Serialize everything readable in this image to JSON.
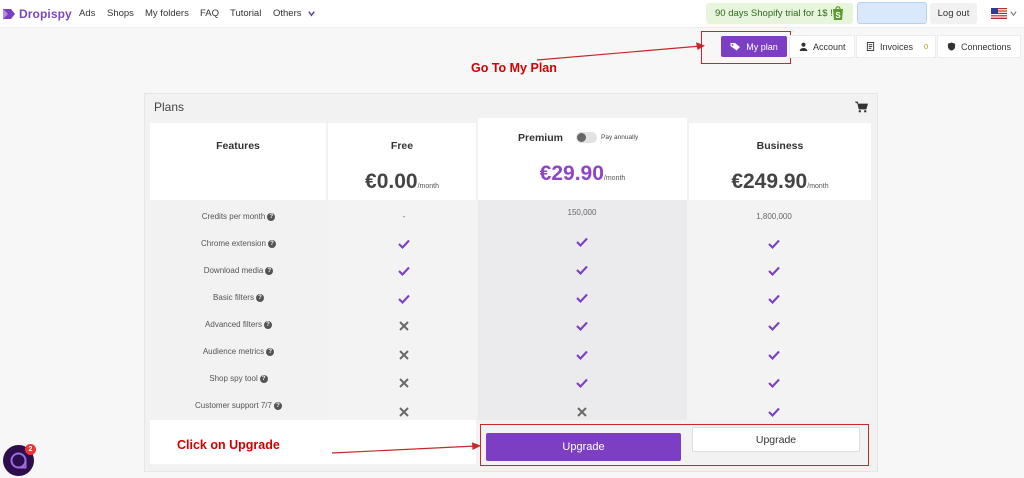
{
  "brand": {
    "name": "Dropispy"
  },
  "nav": {
    "items": [
      "Ads",
      "Shops",
      "My folders",
      "FAQ",
      "Tutorial",
      "Others"
    ],
    "promo": "90 days Shopify trial for 1$ !",
    "logout": "Log out",
    "search_placeholder": "",
    "flag": "us-flag-icon"
  },
  "subnav": {
    "my_plan": "My plan",
    "account": "Account",
    "invoices": "Invoices",
    "invoices_count": "0",
    "connections": "Connections"
  },
  "annotations": {
    "go_to_my_plan": "Go To My Plan",
    "click_on_upgrade": "Click on Upgrade"
  },
  "plans": {
    "title": "Plans",
    "features_header": "Features",
    "pay_annually": "Pay annually",
    "columns": [
      {
        "name": "Free",
        "price": "€0.00",
        "per": "/month"
      },
      {
        "name": "Premium",
        "price": "€29.90",
        "per": "/month"
      },
      {
        "name": "Business",
        "price": "€249.90",
        "per": "/month"
      }
    ],
    "features": [
      {
        "label": "Credits per month",
        "free": "-",
        "premium": "150,000",
        "business": "1,800,000"
      },
      {
        "label": "Chrome extension",
        "free": "check",
        "premium": "check",
        "business": "check"
      },
      {
        "label": "Download media",
        "free": "check",
        "premium": "check",
        "business": "check"
      },
      {
        "label": "Basic filters",
        "free": "check",
        "premium": "check",
        "business": "check"
      },
      {
        "label": "Advanced filters",
        "free": "cross",
        "premium": "check",
        "business": "check"
      },
      {
        "label": "Audience metrics",
        "free": "cross",
        "premium": "check",
        "business": "check"
      },
      {
        "label": "Shop spy tool",
        "free": "cross",
        "premium": "check",
        "business": "check"
      },
      {
        "label": "Customer support 7/7",
        "free": "cross",
        "premium": "cross",
        "business": "check"
      }
    ],
    "upgrade_label": "Upgrade"
  },
  "chat": {
    "badge": "2"
  },
  "colors": {
    "accent": "#7c3fc4",
    "annotation": "#d10000",
    "check": "#7c3fc4",
    "cross": "#6a6a6a"
  }
}
